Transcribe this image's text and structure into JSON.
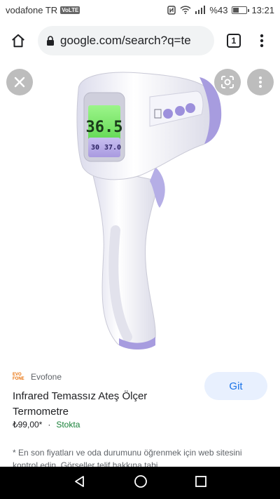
{
  "status": {
    "carrier": "vodafone TR",
    "volte": "VoLTE",
    "battery_percent": "%43",
    "battery_level": 0.43,
    "time": "13:21"
  },
  "browser": {
    "url": "google.com/search?q=te",
    "tab_count": "1"
  },
  "product": {
    "source_logo": "EVO FONE",
    "source": "Evofone",
    "title": "Infrared Temassız Ateş Ölçer Termometre",
    "price": "₺99,00*",
    "separator": "·",
    "stock": "Stokta",
    "go_label": "Git",
    "disclaimer": "* En son fiyatları ve oda durumunu öğrenmek için web sitesini kontrol edin. Görseller telif hakkına tabi"
  },
  "thermometer_display": {
    "main_reading": "36.5",
    "sub_left": "30",
    "sub_right": "37.0"
  },
  "colors": {
    "accent": "#1a73e8",
    "stock": "#188038",
    "device_purple": "#9f94e0",
    "lcd_green": "#7cf06c"
  }
}
